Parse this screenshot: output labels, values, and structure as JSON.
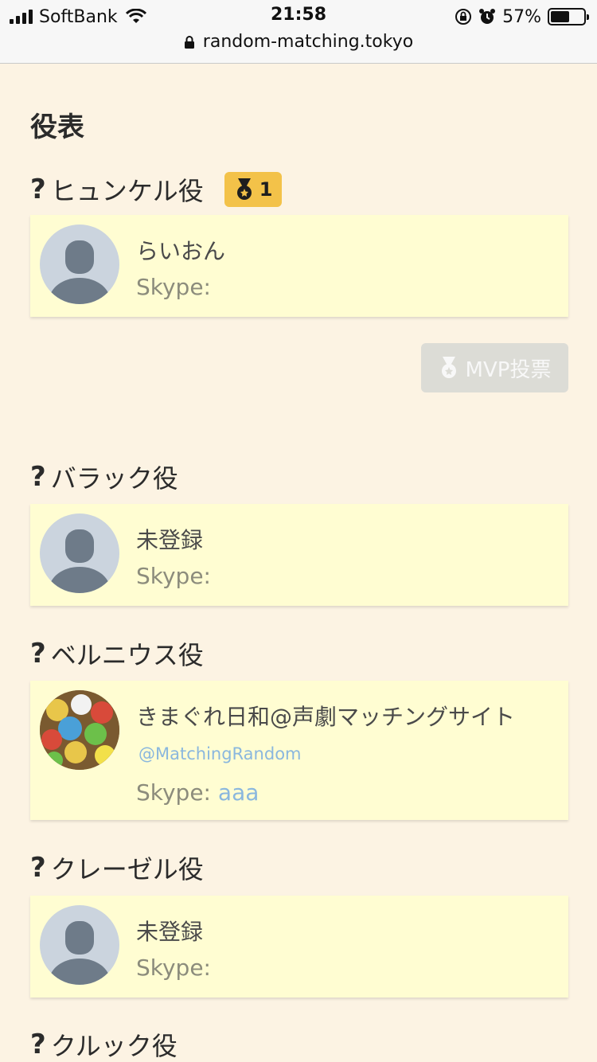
{
  "status": {
    "carrier": "SoftBank",
    "time": "21:58",
    "battery_pct": "57%",
    "battery_level": 0.57,
    "url": "random-matching.tokyo"
  },
  "page": {
    "title": "役表"
  },
  "roles": [
    {
      "role_label": "ヒュンケル役",
      "mvp_count": "1",
      "player_name": "らいおん",
      "skype_label": "Skype:",
      "skype_value": "",
      "vote_button": "MVP投票"
    },
    {
      "role_label": "バラック役",
      "player_name": "未登録",
      "skype_label": "Skype:",
      "skype_value": ""
    },
    {
      "role_label": "ベルニウス役",
      "player_name": "きまぐれ日和@声劇マッチングサイト",
      "twitter": "@MatchingRandom",
      "skype_label": "Skype:",
      "skype_value": "aaa"
    },
    {
      "role_label": "クレーゼル役",
      "player_name": "未登録",
      "skype_label": "Skype:",
      "skype_value": ""
    },
    {
      "role_label": "クルック役"
    }
  ],
  "icons": [
    "question-icon",
    "medal-icon",
    "lock-icon",
    "default-avatar-icon",
    "lottery-balls-avatar"
  ],
  "colors": {
    "background": "#fcf3e3",
    "card": "#fffdd2",
    "badge": "#f3c249",
    "link": "#8ab7de"
  }
}
